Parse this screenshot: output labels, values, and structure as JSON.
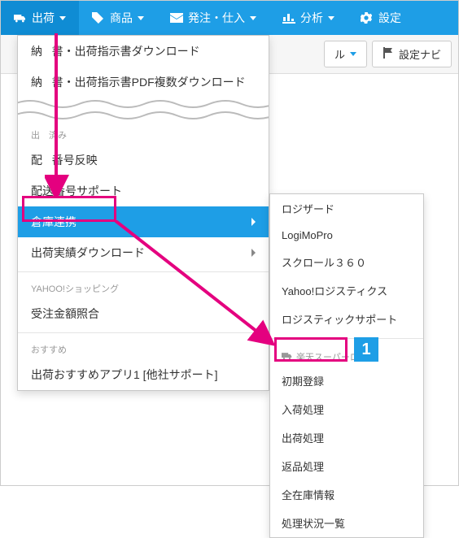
{
  "nav": {
    "shipping": "出荷",
    "products": "商品",
    "orders": "発注・仕入",
    "analytics": "分析",
    "settings": "設定"
  },
  "toolbar": {
    "btn_ru": "ル",
    "settings_nav": "設定ナビ"
  },
  "dropdown": {
    "item_dl1_prefix": "納",
    "item_dl1_rest": "書・出荷指示書ダウンロード",
    "item_dl2_prefix": "納",
    "item_dl2_rest": "書・出荷指示書PDF複数ダウンロード",
    "header_done": "出　済み",
    "item_tracking_reflect_prefix": "配",
    "item_tracking_reflect_rest": "番号反映",
    "item_tracking_support": "配送番号サポート",
    "item_warehouse": "倉庫連携",
    "item_result_dl": "出荷実績ダウンロード",
    "header_yahoo": "YAHOO!ショッピング",
    "item_receivable": "受注金額照合",
    "header_recommend": "おすすめ",
    "item_recommend_app": "出荷おすすめアプリ1 [他社サポート]"
  },
  "submenu": {
    "items_top": [
      "ロジザード",
      "LogiMoPro",
      "スクロール３６０",
      "Yahoo!ロジスティクス",
      "ロジスティックサポート"
    ],
    "header_rakuten": "楽天スーパーロジ",
    "items_rakuten": [
      "初期登録",
      "入荷処理",
      "出荷処理",
      "返品処理",
      "全在庫情報",
      "処理状況一覧"
    ]
  },
  "annotation": {
    "step": "1"
  }
}
